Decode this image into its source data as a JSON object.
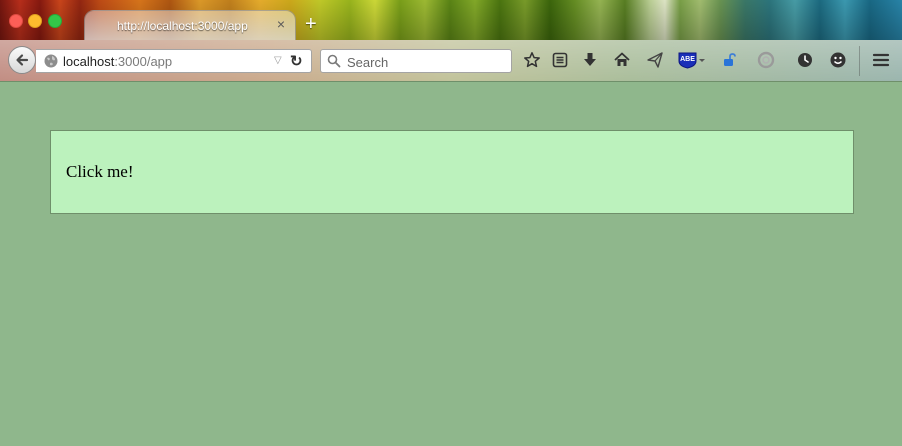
{
  "window": {
    "tab": {
      "title": "http://localhost:3000/app",
      "close": "×"
    },
    "new_tab": "+"
  },
  "navbar": {
    "url": {
      "host": "localhost",
      "path": ":3000/app"
    },
    "reload_glyph": "↻",
    "search": {
      "placeholder": "Search",
      "value": ""
    },
    "icons": [
      "back-arrow-icon",
      "globe-icon",
      "dropdown-triangle-icon",
      "reload-icon",
      "search-icon",
      "star-icon",
      "reading-list-icon",
      "download-icon",
      "home-icon",
      "send-icon",
      "abe-shield-icon",
      "lock-icon",
      "circle-icon",
      "history-icon",
      "smiley-icon",
      "hamburger-menu-icon"
    ],
    "abe_label": "ABE"
  },
  "page": {
    "button_label": "Click me!",
    "background": "#8fb78c",
    "box_color": "#bcf2bd"
  }
}
